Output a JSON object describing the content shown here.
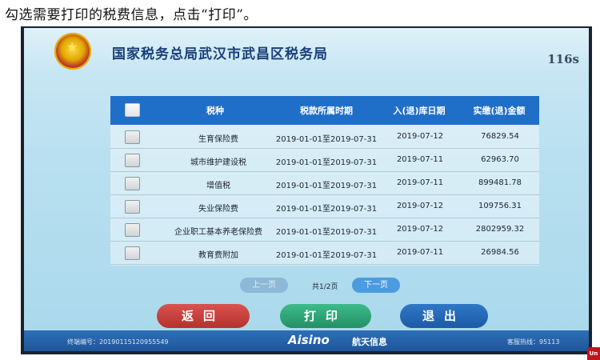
{
  "caption": "勾选需要打印的税费信息，点击“打印”。",
  "header": {
    "agency": "国家税务总局武汉市武昌区税务局",
    "countdown": "116s"
  },
  "table": {
    "columns": [
      "税种",
      "税款所属时期",
      "入(退)库日期",
      "实缴(退)金额"
    ],
    "rows": [
      {
        "tax": "生育保险费",
        "period": "2019-01-01至2019-07-31",
        "date": "2019-07-12",
        "amount": "76829.54"
      },
      {
        "tax": "城市维护建设税",
        "period": "2019-01-01至2019-07-31",
        "date": "2019-07-11",
        "amount": "62963.70"
      },
      {
        "tax": "增值税",
        "period": "2019-01-01至2019-07-31",
        "date": "2019-07-11",
        "amount": "899481.78"
      },
      {
        "tax": "失业保险费",
        "period": "2019-01-01至2019-07-31",
        "date": "2019-07-12",
        "amount": "109756.31"
      },
      {
        "tax": "企业职工基本养老保险费",
        "period": "2019-01-01至2019-07-31",
        "date": "2019-07-12",
        "amount": "2802959.32"
      },
      {
        "tax": "教育费附加",
        "period": "2019-01-01至2019-07-31",
        "date": "2019-07-11",
        "amount": "26984.56"
      }
    ]
  },
  "pager": {
    "prev_label": "上一页",
    "info": "共1/2页",
    "next_label": "下一页"
  },
  "actions": {
    "back_label": "返回",
    "print_label": "打印",
    "exit_label": "退出"
  },
  "footer": {
    "terminal": "终端编号：20190115120955549",
    "brand": "Aisino",
    "brand_cn": "航天信息",
    "hotline": "客服热线：95113"
  },
  "colors": {
    "header_blue": "#1f6fc8",
    "back_red": "#c0392b",
    "print_green": "#2e9d72",
    "exit_blue": "#1f5fae",
    "footer_blue": "#2d6fb7"
  }
}
